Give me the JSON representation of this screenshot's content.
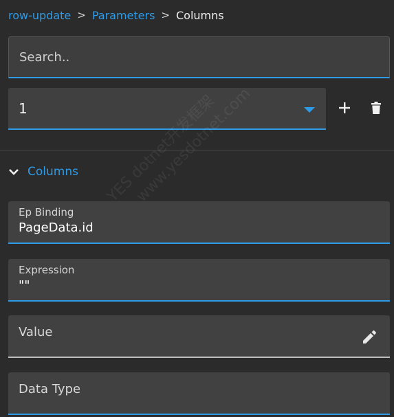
{
  "breadcrumb": {
    "items": [
      "row-update",
      "Parameters"
    ],
    "separator": ">",
    "current": "Columns"
  },
  "search": {
    "placeholder": "Search..",
    "value": ""
  },
  "selector": {
    "value": "1"
  },
  "actions": {
    "add_icon": "plus-icon",
    "delete_icon": "trash-icon"
  },
  "section": {
    "title": "Columns",
    "expanded": true
  },
  "fields": [
    {
      "label": "Ep Binding",
      "value": "PageData.id"
    },
    {
      "label": "Expression",
      "value": "\"\""
    },
    {
      "label": "Value",
      "value": ""
    },
    {
      "label": "Data Type",
      "value": ""
    }
  ],
  "watermark": [
    "YES dotnet开发框架",
    "www.yesdotnet.com"
  ],
  "colors": {
    "accent": "#2f9be6",
    "background": "#2b2b2b",
    "field": "#414141"
  }
}
